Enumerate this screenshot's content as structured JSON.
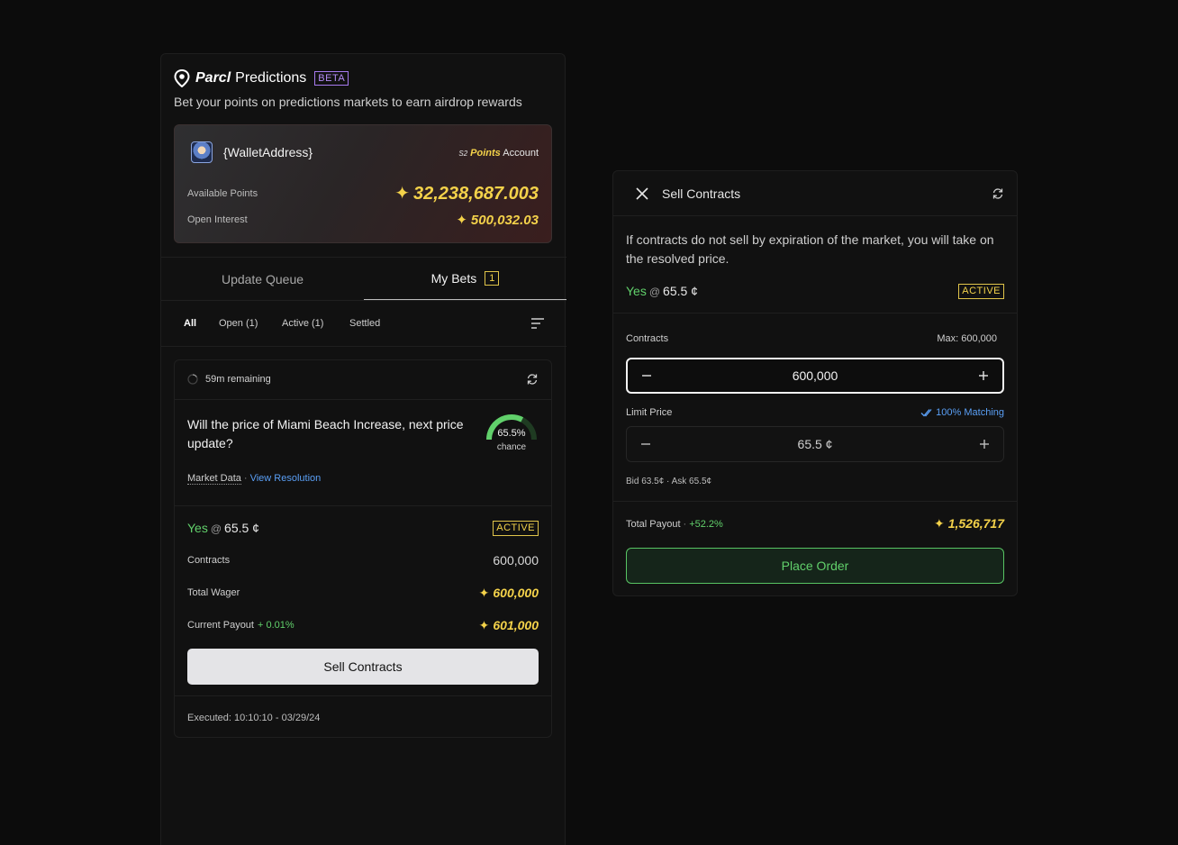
{
  "app": {
    "brand_name": "Parcl",
    "product_name": "Predictions",
    "beta_label": "BETA",
    "subtitle": "Bet your points on predictions markets to earn airdrop rewards"
  },
  "account": {
    "wallet": "{WalletAddress}",
    "season": "S2",
    "points_word": "Points",
    "account_word": "Account",
    "available_label": "Available Points",
    "available_value": "32,238,687.003",
    "open_interest_label": "Open Interest",
    "open_interest_value": "500,032.03",
    "star_glyph": "✦"
  },
  "tabs": [
    {
      "label": "Update Queue",
      "active": false
    },
    {
      "label": "My Bets",
      "active": true,
      "count": "1"
    }
  ],
  "filters": [
    {
      "label": "All",
      "active": true
    },
    {
      "label": "Open (1)",
      "active": false
    },
    {
      "label": "Active (1)",
      "active": false
    },
    {
      "label": "Settled",
      "active": false
    }
  ],
  "bet": {
    "remaining": "59m remaining",
    "question": "Will the price of Miami Beach Increase, next price update?",
    "chance_pct": "65.5%",
    "chance_label": "chance",
    "chance_value": 0.655,
    "market_data": "Market Data",
    "view_resolution": "View Resolution",
    "side": "Yes",
    "at": "@",
    "price": "65.5 ¢",
    "status": "ACTIVE",
    "contracts_label": "Contracts",
    "contracts_value": "600,000",
    "wager_label": "Total Wager",
    "wager_value": "600,000",
    "payout_label": "Current Payout",
    "payout_change": "+ 0.01%",
    "payout_value": "601,000",
    "sell_button": "Sell Contracts",
    "executed": "Executed: 10:10:10 - 03/29/24"
  },
  "sell_panel": {
    "title": "Sell Contracts",
    "info": "If contracts do not sell by expiration of the market, you will take on the resolved price.",
    "side": "Yes",
    "at": "@",
    "price": "65.5 ¢",
    "status": "ACTIVE",
    "contracts_label": "Contracts",
    "max_label": "Max: 600,000",
    "contracts_value": "600,000",
    "limit_label": "Limit Price",
    "matching_label": "100% Matching",
    "limit_value": "65.5 ¢",
    "bid_ask": "Bid 63.5¢ · Ask 65.5¢",
    "payout_label": "Total Payout",
    "payout_change": "+52.2%",
    "payout_value": "1,526,717",
    "place_button": "Place Order"
  },
  "colors": {
    "gold": "#f4d24a",
    "green": "#61d06b",
    "blue": "#5a9ff5",
    "purple": "#b48cf5",
    "background": "#0c0c0c",
    "panel": "#111111"
  }
}
